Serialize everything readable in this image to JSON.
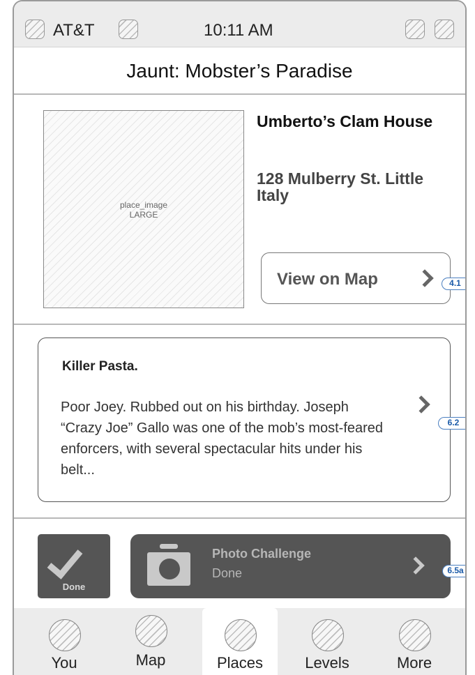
{
  "status_bar": {
    "carrier": "AT&T",
    "time": "10:11 AM"
  },
  "header": {
    "title": "Jaunt: Mobster’s Paradise"
  },
  "place": {
    "image_placeholder_line1": "place_image",
    "image_placeholder_line2": "LARGE",
    "name": "Umberto’s Clam House",
    "address": "128 Mulberry St. Little Italy",
    "map_button_label": "View on Map",
    "map_callout": "4.1"
  },
  "story": {
    "heading": "Killer Pasta.",
    "body": "Poor Joey. Rubbed out on his birthday. Joseph “Crazy Joe” Gallo was one of the mob’s most-feared enforcers, with several spectacular hits under his belt...",
    "callout": "6.2"
  },
  "actions": {
    "done_label": "Done",
    "photo_title": "Photo Challenge",
    "photo_status": "Done",
    "photo_callout": "6.5a"
  },
  "tabs": [
    {
      "label": "You",
      "icon": "placeholder-icon"
    },
    {
      "label": "Map",
      "icon": "placeholder-icon"
    },
    {
      "label": "Places",
      "icon": "placeholder-icon",
      "active": true
    },
    {
      "label": "Levels",
      "icon": "placeholder-icon"
    },
    {
      "label": "More",
      "icon": "placeholder-icon"
    }
  ]
}
